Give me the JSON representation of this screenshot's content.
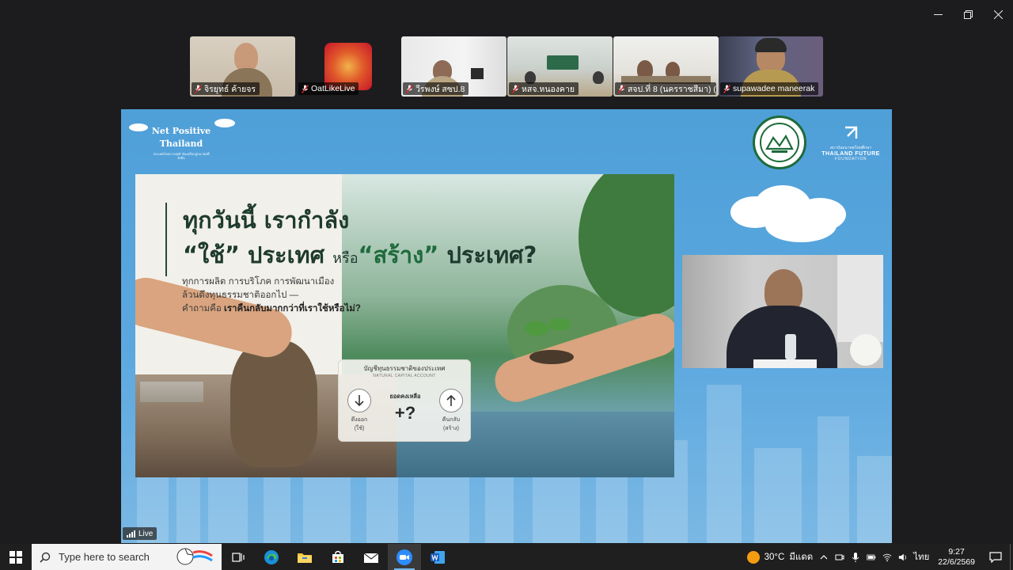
{
  "window": {
    "controls": [
      "minimize",
      "restore",
      "close"
    ]
  },
  "participants": [
    {
      "name": "จิรยุทธ์ ค้ายจร",
      "muted": true
    },
    {
      "name": "OatLikeLive",
      "muted": true
    },
    {
      "name": "วีรพงษ์ สซป.8",
      "muted": true
    },
    {
      "name": "หสจ.หนองคาย",
      "muted": true
    },
    {
      "name": "สจป.ที่ 8 (นครราชสีมา) (น...",
      "muted": true
    },
    {
      "name": "supawadee maneerak",
      "muted": true
    }
  ],
  "share": {
    "brand_title": "Net Positive Thailand",
    "brand_line1": "Net Positive",
    "brand_line2": "Thailand",
    "brand_sub": "ประเทศไทยบวกสุทธิ ขับเคลื่อนสู่อนาคตที่ยั่งยืน",
    "tff_name": "THAILAND FUTURE",
    "tff_sub": "FOUNDATION",
    "tff_thai": "สถาบันอนาคตไทยศึกษา",
    "live_label": "Live"
  },
  "slide": {
    "headline_line1": "ทุกวันนี้ เรากำลัง",
    "headline_use": "“ใช้” ประเทศ",
    "headline_or": "หรือ",
    "headline_build": "“สร้าง”",
    "headline_country": "ประเทศ?",
    "sub_line1": "ทุกการผลิต การบริโภค การพัฒนาเมือง",
    "sub_line2": "ล้วนดึงทุนธรรมชาติออกไป —",
    "sub_line3_plain": "คำถามคือ ",
    "sub_line3_bold": "เราคืนกลับมากกว่าที่เราใช้หรือไม่?",
    "account_title": "บัญชีทุนธรรมชาติของประเทศ",
    "account_sub": "NATURAL CAPITAL ACCOUNT",
    "withdraw_label": "ดึงออก",
    "withdraw_sub": "(ใช้)",
    "balance_label": "ยอดคงเหลือ",
    "balance_value": "+?",
    "return_label": "คืนกลับ",
    "return_sub": "(สร้าง)"
  },
  "taskbar": {
    "search_placeholder": "Type here to search",
    "apps": [
      "task-view",
      "edge",
      "file-explorer",
      "store",
      "mail",
      "zoom",
      "word"
    ],
    "active_app": "zoom",
    "weather_temp": "30°C",
    "weather_text": "มีแดด",
    "language": "ไทย",
    "time": "9:27",
    "date": "22/6/2569"
  },
  "colors": {
    "background": "#1c1c1f",
    "share_blue": "#5ba8df",
    "headline_green": "#1f6b3d",
    "taskbar": "#1f1f1f"
  }
}
